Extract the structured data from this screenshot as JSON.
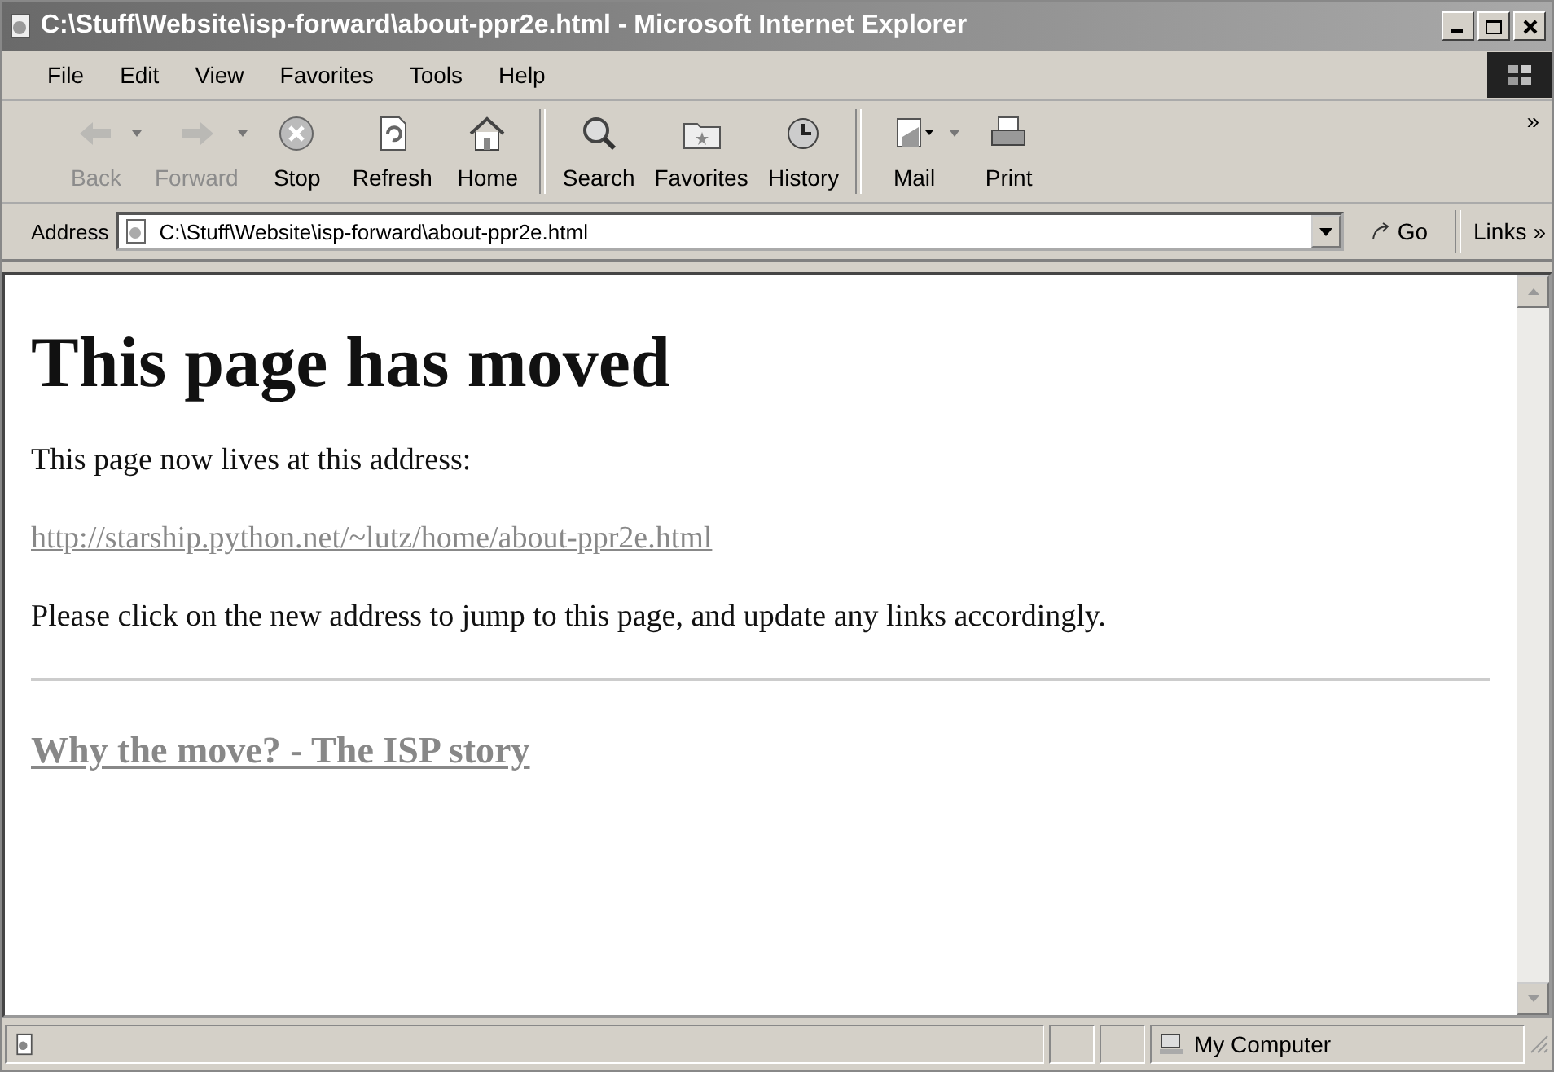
{
  "window": {
    "title": "C:\\Stuff\\Website\\isp-forward\\about-ppr2e.html - Microsoft Internet Explorer"
  },
  "menu": [
    "File",
    "Edit",
    "View",
    "Favorites",
    "Tools",
    "Help"
  ],
  "toolbar": [
    {
      "buttons": [
        {
          "label": "Back",
          "kind": "back",
          "disabled": true,
          "dropdown": true
        },
        {
          "label": "Forward",
          "kind": "forward",
          "disabled": true,
          "dropdown": true
        },
        {
          "label": "Stop",
          "kind": "stop",
          "disabled": false,
          "dropdown": false
        },
        {
          "label": "Refresh",
          "kind": "refresh",
          "disabled": false,
          "dropdown": false
        },
        {
          "label": "Home",
          "kind": "home",
          "disabled": false,
          "dropdown": false
        }
      ]
    },
    {
      "buttons": [
        {
          "label": "Search",
          "kind": "search",
          "disabled": false,
          "dropdown": false
        },
        {
          "label": "Favorites",
          "kind": "favorites",
          "disabled": false,
          "dropdown": false
        },
        {
          "label": "History",
          "kind": "history",
          "disabled": false,
          "dropdown": false
        }
      ]
    },
    {
      "buttons": [
        {
          "label": "Mail",
          "kind": "mail",
          "disabled": false,
          "dropdown": true
        },
        {
          "label": "Print",
          "kind": "print",
          "disabled": false,
          "dropdown": false
        }
      ]
    }
  ],
  "more_chevron": "»",
  "address": {
    "label": "Address",
    "value": "C:\\Stuff\\Website\\isp-forward\\about-ppr2e.html",
    "go": "Go",
    "links": "Links",
    "links_chevron": "»"
  },
  "page": {
    "heading": "This page has moved",
    "intro": "This page now lives at this address:",
    "link": "http://starship.python.net/~lutz/home/about-ppr2e.html",
    "note": "Please click on the new address to jump to this page, and update any links accordingly.",
    "subheading_link": "Why the move? - The ISP story"
  },
  "status_bar": {
    "zone": "My Computer"
  }
}
